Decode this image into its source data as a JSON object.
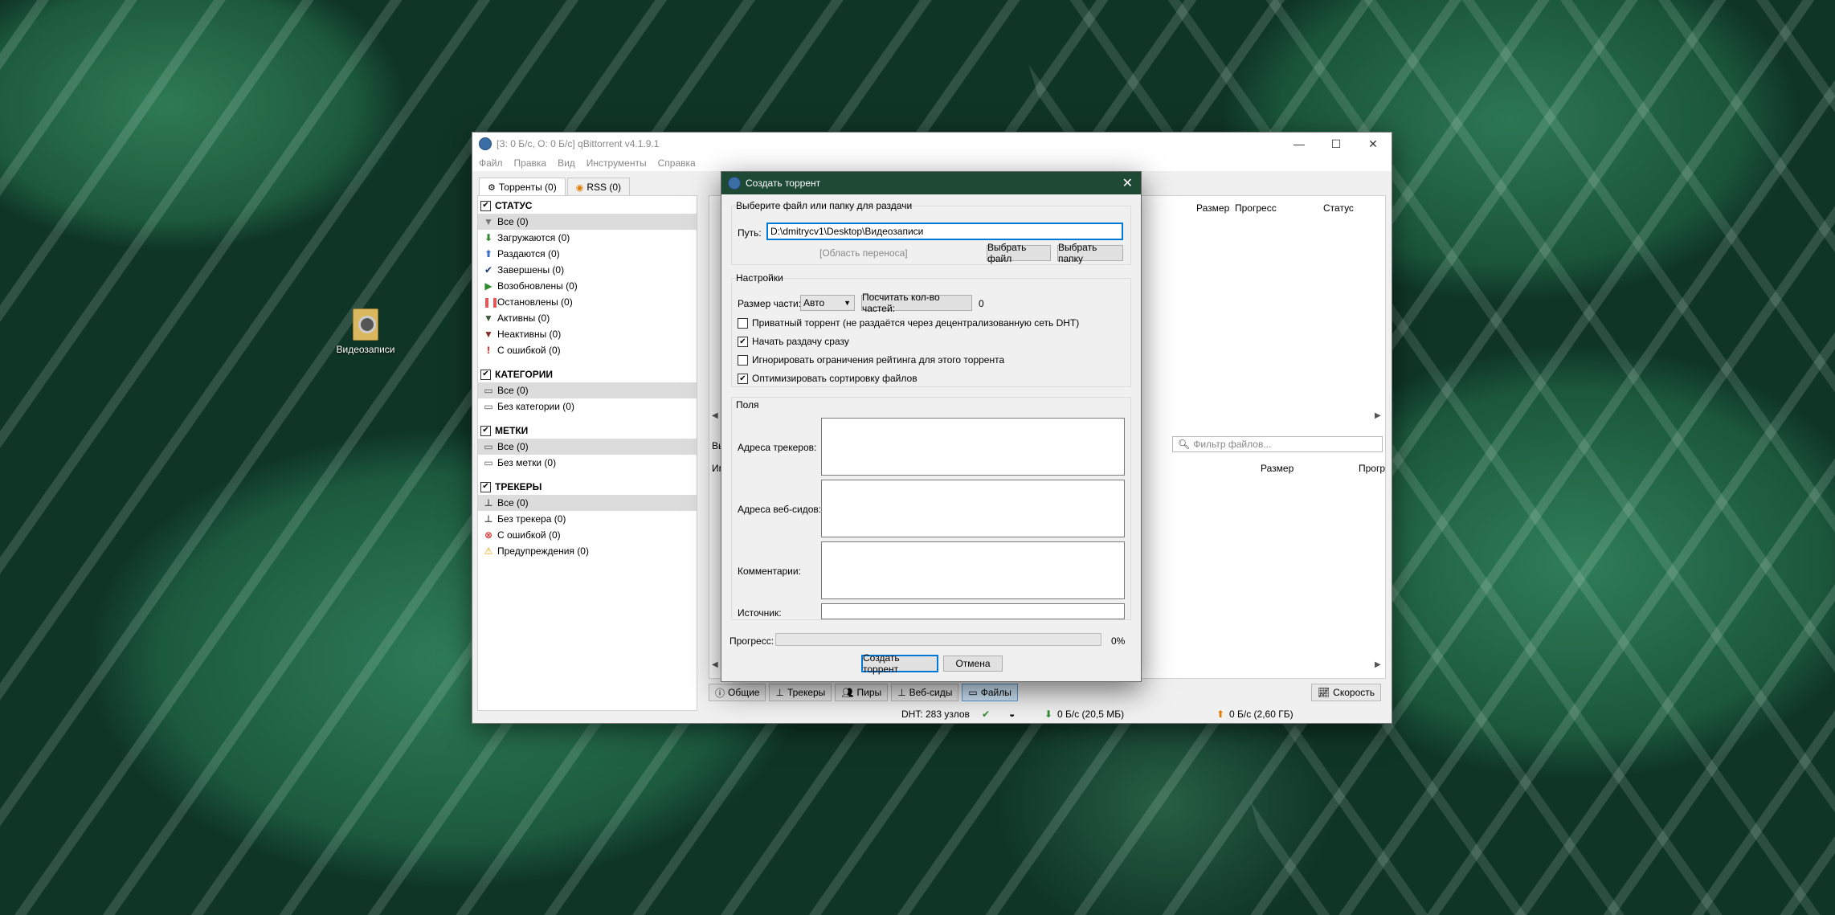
{
  "desktop": {
    "icon_label": "Видеозаписи"
  },
  "window": {
    "title": "[З: 0 Б/с, О: 0 Б/с] qBittorrent v4.1.9.1",
    "controls": {
      "minimize": "—",
      "maximize": "☐",
      "close": "✕"
    },
    "menu": [
      "Файл",
      "Правка",
      "Вид",
      "Инструменты",
      "Справка"
    ],
    "tabs": [
      "Торренты (0)",
      "RSS (0)"
    ]
  },
  "sidebar": {
    "status_header": "СТАТУС",
    "status": [
      "Все (0)",
      "Загружаются (0)",
      "Раздаются (0)",
      "Завершены (0)",
      "Возобновлены (0)",
      "Остановлены (0)",
      "Активны (0)",
      "Неактивны (0)",
      "С ошибкой (0)"
    ],
    "categories_header": "КАТЕГОРИИ",
    "categories": [
      "Все (0)",
      "Без категории (0)"
    ],
    "tags_header": "МЕТКИ",
    "tags": [
      "Все (0)",
      "Без метки (0)"
    ],
    "trackers_header": "ТРЕКЕРЫ",
    "trackers": [
      "Все (0)",
      "Без трекера (0)",
      "С ошибкой (0)",
      "Предупреждения (0)"
    ]
  },
  "content": {
    "columns": [
      "Размер",
      "Прогресс",
      "Статус"
    ],
    "files_columns": [
      "Им",
      "Размер",
      "Прогр"
    ],
    "files_prefix": "Вы",
    "filter_placeholder": "Фильтр файлов...",
    "bottom_tabs": [
      "Общие",
      "Трекеры",
      "Пиры",
      "Веб-сиды",
      "Файлы"
    ],
    "speed_button": "Скорость"
  },
  "statusbar": {
    "dht": "DHT: 283 узлов",
    "download": "0 Б/с (20,5 МБ)",
    "upload": "0 Б/с (2,60 ГБ)"
  },
  "dialog": {
    "title": "Создать торрент",
    "source_group": "Выберите файл или папку для раздачи",
    "path_label": "Путь:",
    "path_value": "D:\\dmitrycv1\\Desktop\\Видеозаписи",
    "drop_hint": "[Область переноса]",
    "choose_file": "Выбрать файл",
    "choose_folder": "Выбрать папку",
    "settings_group": "Настройки",
    "piece_size_label": "Размер части:",
    "piece_size_value": "Авто",
    "calc_pieces": "Посчитать кол-во частей:",
    "pieces_count": "0",
    "checkboxes": [
      {
        "label": "Приватный торрент (не раздаётся через децентрализованную сеть DHT)",
        "checked": false
      },
      {
        "label": "Начать раздачу сразу",
        "checked": true
      },
      {
        "label": "Игнорировать ограничения рейтинга для этого торрента",
        "checked": false
      },
      {
        "label": "Оптимизировать сортировку файлов",
        "checked": true
      }
    ],
    "fields_group": "Поля",
    "trackers_label": "Адреса трекеров:",
    "webseeds_label": "Адреса веб-сидов:",
    "comments_label": "Комментарии:",
    "source_label": "Источник:",
    "progress_label": "Прогресс:",
    "progress_value": 0,
    "progress_text": "0%",
    "create_button": "Создать торрент",
    "cancel_button": "Отмена"
  },
  "colors": {
    "dialog_title_bg": "#1e4934",
    "accent": "#0078d7"
  }
}
